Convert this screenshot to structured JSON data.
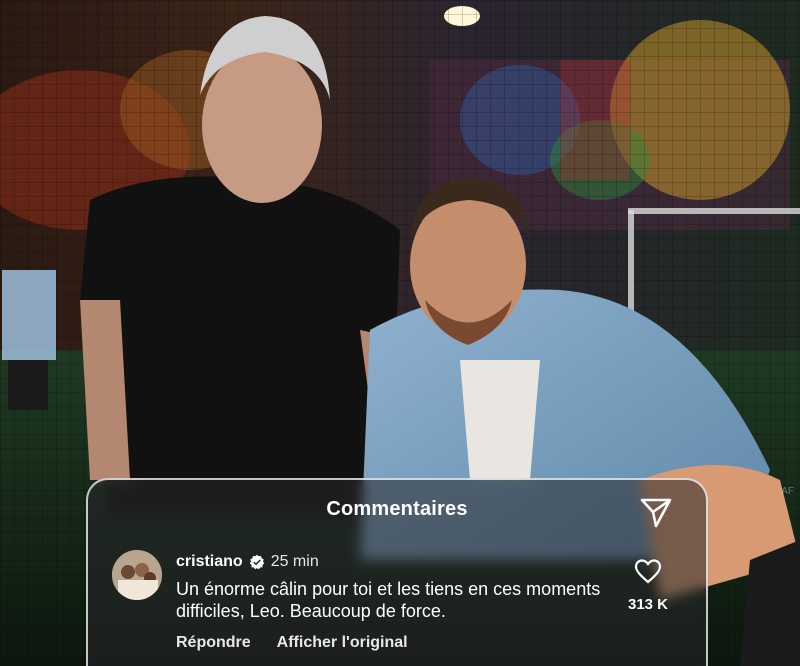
{
  "comments_panel": {
    "title": "Commentaires",
    "share_icon": "send-paper-plane-icon"
  },
  "comment": {
    "username": "cristiano",
    "verified_icon": "verified-badge-icon",
    "time": "25 min",
    "text": "Un énorme câlin pour toi et les tiens en ces moments difficiles, Leo. Beaucoup de force.",
    "reply_label": "Répondre",
    "translate_label": "Afficher l'original",
    "like_icon": "heart-outline-icon",
    "like_count": "313 K"
  },
  "photo": {
    "watermark": "AF"
  },
  "colors": {
    "panel_border": "#ffffff",
    "text": "#ffffff",
    "verified": "#ffffff"
  }
}
